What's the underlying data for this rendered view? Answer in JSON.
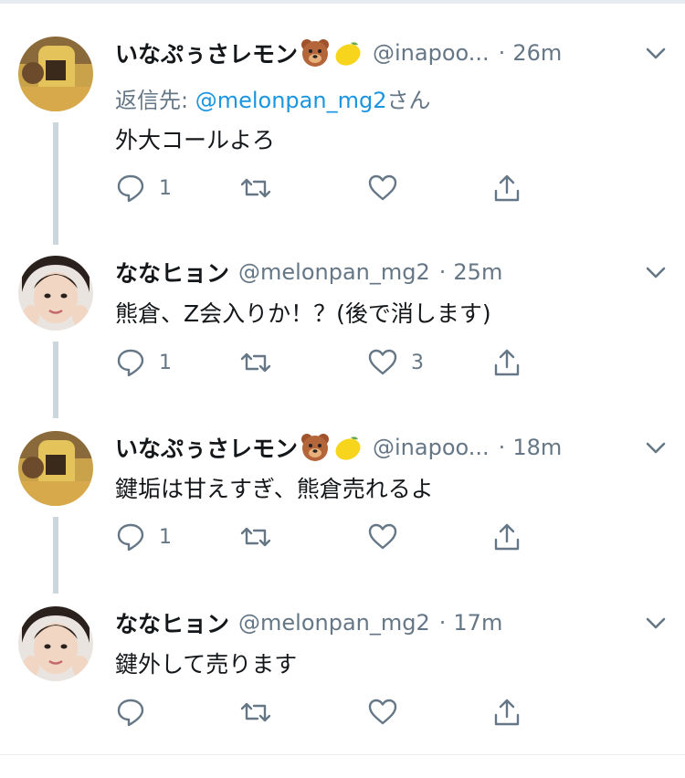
{
  "tweets": [
    {
      "name": "いなぷぅさレモン",
      "handle": "@inapoo...",
      "time": "26m",
      "reply_prefix": "返信先: ",
      "reply_user": "@melonpan_mg2",
      "reply_suffix": "さん",
      "text": "外大コールよろ",
      "reply_count": "1",
      "retweet_count": "",
      "like_count": "",
      "has_emoji": true
    },
    {
      "name": "ななヒョン",
      "handle": "@melonpan_mg2",
      "time": "25m",
      "text": "熊倉、Z会入りか！？(後で消します)",
      "reply_count": "1",
      "retweet_count": "",
      "like_count": "3",
      "has_emoji": false
    },
    {
      "name": "いなぷぅさレモン",
      "handle": "@inapoo...",
      "time": "18m",
      "text": "鍵垢は甘えすぎ、熊倉売れるよ",
      "reply_count": "1",
      "retweet_count": "",
      "like_count": "",
      "has_emoji": true
    },
    {
      "name": "ななヒョン",
      "handle": "@melonpan_mg2",
      "time": "17m",
      "text": "鍵外して売ります",
      "reply_count": "",
      "retweet_count": "",
      "like_count": "",
      "has_emoji": false
    }
  ],
  "separator_dot": "·",
  "icons": {
    "reply": "reply-icon",
    "retweet": "retweet-icon",
    "like": "heart-icon",
    "share": "share-icon",
    "more": "chevron-down-icon"
  },
  "colors": {
    "text": "#14171a",
    "secondary": "#657786",
    "link": "#1b95e0",
    "thread_line": "#ccd6dd",
    "divider": "#e6ecf0"
  }
}
